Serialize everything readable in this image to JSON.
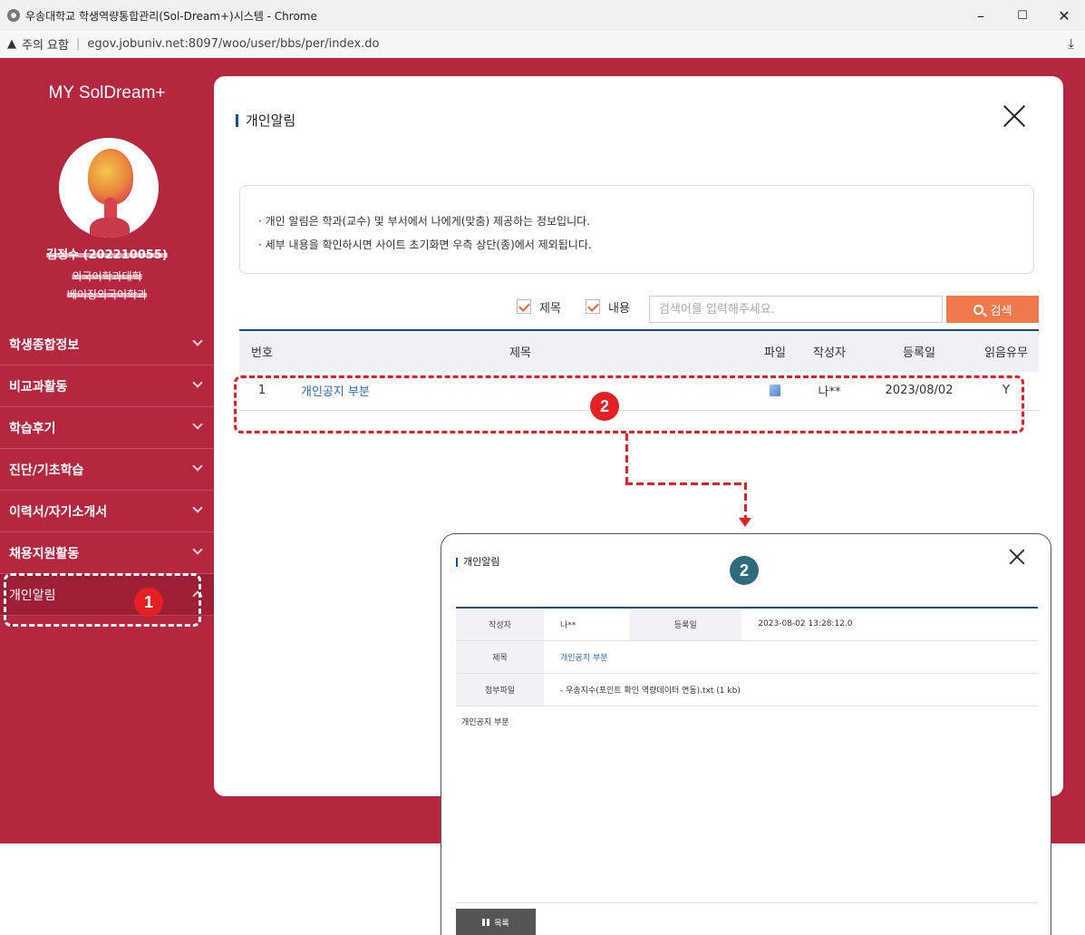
{
  "browser": {
    "window_title": "우송대학교 학생역량통합관리(Sol-Dream+)시스템 - Chrome",
    "security_warning": "주의 요함",
    "url": "egov.jobuniv.net:8097/woo/user/bbs/per/index.do",
    "minimize": "–",
    "maximize": "☐",
    "close": "✕",
    "download": "⤓"
  },
  "sidebar": {
    "brand": "MY SolDream+",
    "profile": {
      "name": "김정수 (202210055)",
      "college": "외국어학과대학",
      "department": "베이징외국어학과"
    },
    "menu": [
      {
        "label": "학생종합정보"
      },
      {
        "label": "비교과활동"
      },
      {
        "label": "학습후기"
      },
      {
        "label": "진단/기초학습"
      },
      {
        "label": "이력서/자기소개서"
      },
      {
        "label": "채용지원활동"
      },
      {
        "label": "개인알림"
      }
    ]
  },
  "main": {
    "title": "개인알림",
    "notice_lines": [
      "· 개인 알림은 학과(교수) 및 부서에서 나에게(맞춤) 제공하는 정보입니다.",
      "· 세부 내용을 확인하시면 사이트 초기화면 우측 상단(종)에서 제외됩니다."
    ],
    "search": {
      "check_title": "제목",
      "check_content": "내용",
      "placeholder": "검색어를 입력해주세요.",
      "button": "검색"
    },
    "table": {
      "headers": [
        "번호",
        "제목",
        "파일",
        "작성자",
        "등록일",
        "읽음유무"
      ],
      "rows": [
        {
          "no": "1",
          "title": "개인공지 부분",
          "author": "나**",
          "date": "2023/08/02",
          "read": "Y"
        }
      ]
    }
  },
  "annotations": {
    "marker1": "1",
    "marker2": "2",
    "colors": {
      "red": "#e32124",
      "marker_red": "#e32124",
      "marker_teal": "#2f6b7f"
    }
  },
  "popup": {
    "title": "개인알림",
    "author_label": "작성자",
    "author": "나**",
    "date_label": "등록일",
    "date": "2023-08-02 13:28:12.0",
    "subject_label": "제목",
    "subject": "개인공지 부분",
    "attachment_label": "첨부파일",
    "attachment": "- 우송지수(포인트 확인 역량데이터 연동).txt (1 kb)",
    "body": "개인공지 부분",
    "list_button": "목록"
  },
  "colors": {
    "sidebar_bg": "#b5263f",
    "accent_navy": "#1c4b8c",
    "search_orange": "#f07a4b",
    "link_blue": "#2c6cb0"
  }
}
